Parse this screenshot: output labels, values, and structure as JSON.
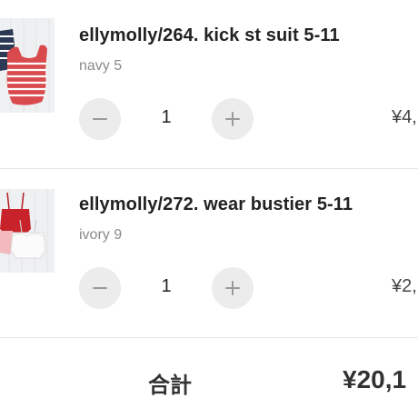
{
  "cart": {
    "items": [
      {
        "title": "ellymolly/264. kick st suit 5-11",
        "variant": "navy 5",
        "quantity": "1",
        "price": "¥4,",
        "image": "striped-romper-product-thumbnail"
      },
      {
        "title": "ellymolly/272. wear bustier 5-11",
        "variant": "ivory 9",
        "quantity": "1",
        "price": "¥2,",
        "image": "bustier-top-product-thumbnail"
      }
    ],
    "total": {
      "label": "合計",
      "value": "¥20,1"
    }
  },
  "icons": {
    "decrease": "minus-icon",
    "increase": "plus-icon"
  },
  "colors": {
    "button_bg": "#ececec",
    "icon": "#9a9a9a",
    "text": "#222222",
    "muted": "#8a8a8a",
    "divider": "#e6e6e6"
  }
}
